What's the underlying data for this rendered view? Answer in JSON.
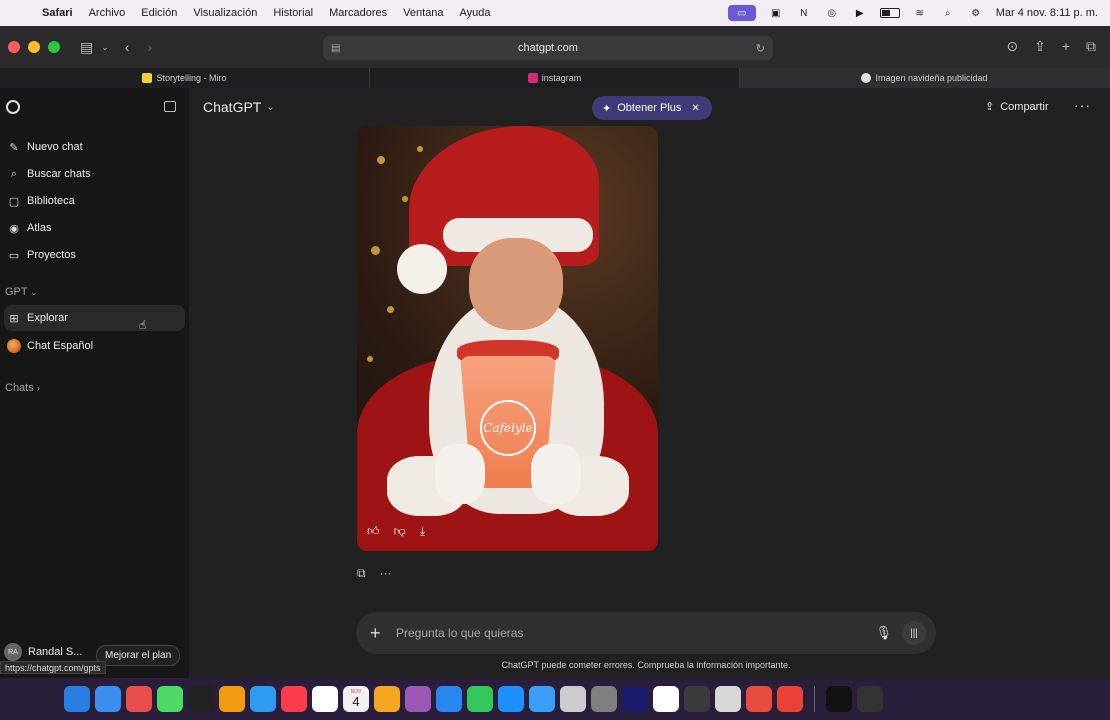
{
  "menubar": {
    "app_name": "Safari",
    "items": [
      "Archivo",
      "Edición",
      "Visualización",
      "Historial",
      "Marcadores",
      "Ventana",
      "Ayuda"
    ],
    "clock": "Mar 4 nov.  8:11 p. m."
  },
  "browser": {
    "url": "chatgpt.com",
    "tabs": [
      {
        "label": "Storytelling - Miro",
        "color": "#f2d03b"
      },
      {
        "label": "instagram",
        "color": "#d62976"
      },
      {
        "label": "Imagen navideña publicidad",
        "color": "#e0e0e0"
      }
    ]
  },
  "sidebar": {
    "items": [
      {
        "label": "Nuevo chat",
        "icon": "new-chat-icon"
      },
      {
        "label": "Buscar chats",
        "icon": "search-icon"
      },
      {
        "label": "Biblioteca",
        "icon": "library-icon"
      },
      {
        "label": "Atlas",
        "icon": "compass-icon"
      },
      {
        "label": "Proyectos",
        "icon": "folder-icon"
      }
    ],
    "gpt_section": "GPT",
    "gpt_items": [
      {
        "label": "Explorar",
        "icon": "grid-icon"
      },
      {
        "label": "Chat Español",
        "icon": "gpt-avatar-icon"
      }
    ],
    "chats_section": "Chats",
    "user": {
      "initials": "RA",
      "name": "Randal S..."
    },
    "upgrade_label": "Mejorar el plan",
    "status_url": "https://chatgpt.com/gpts"
  },
  "header": {
    "model": "ChatGPT",
    "plus_label": "Obtener Plus",
    "share_label": "Compartir"
  },
  "image": {
    "cup_logo_text": "Cafelyle"
  },
  "composer": {
    "placeholder": "Pregunta lo que quieras",
    "disclaimer": "ChatGPT puede cometer errores. Comprueba la información importante."
  },
  "dock": {
    "calendar_month": "NOV",
    "calendar_day": "4",
    "apps": [
      "#2a7de1",
      "#3c8ef0",
      "#e94e4e",
      "#4cd964",
      "#222222",
      "#f39c12",
      "#2e9bf0",
      "#fa3c4c",
      "#ffffff",
      "#f0f0f0",
      "#f5a623",
      "#9b59b6",
      "#2a87f0",
      "#34c759",
      "#1e90ff",
      "#3aa0f7",
      "#cccccc",
      "#7f7f7f",
      "#1c1c6e",
      "#ffffff",
      "#3b3b3b",
      "#d8d8d8",
      "#e74c3c",
      "#ea4335",
      "#111111",
      "#333333"
    ]
  }
}
